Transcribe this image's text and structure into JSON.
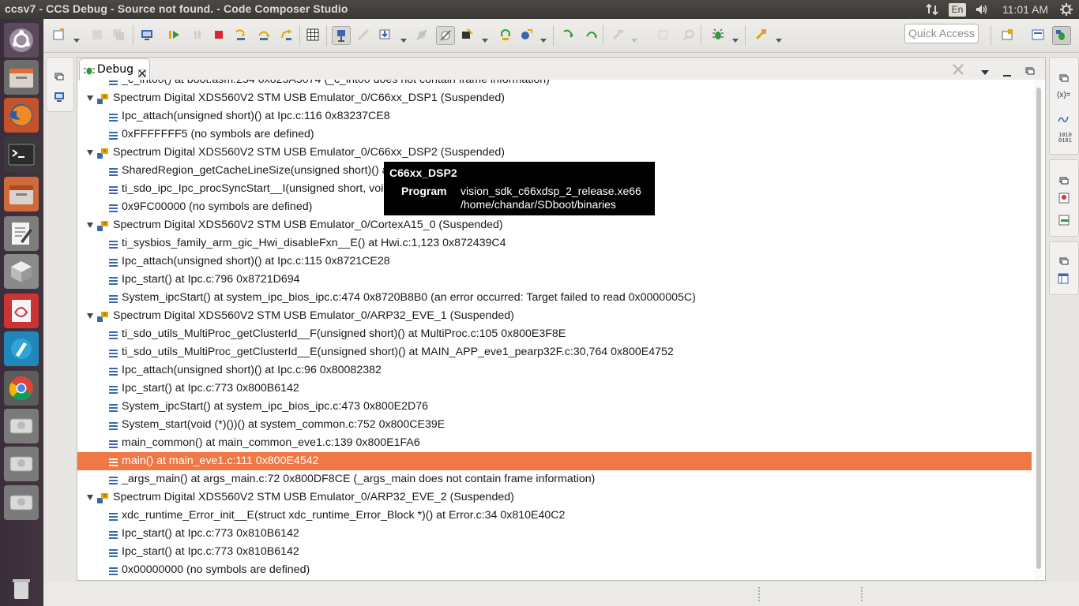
{
  "window": {
    "title": "ccsv7 - CCS Debug - Source not found. - Code Composer Studio"
  },
  "indicators": {
    "language": "En",
    "time": "11:01 AM"
  },
  "toolbar": {
    "quick_access_placeholder": "Quick Access"
  },
  "debug_view": {
    "tab_label": "Debug",
    "rows": [
      {
        "level": 2,
        "kind": "frame",
        "text": "_c_int00() at boot.asm:254 0x823A5074  (_c_int00 does not contain frame information)"
      },
      {
        "level": 1,
        "kind": "target",
        "text": "Spectrum Digital XDS560V2 STM USB Emulator_0/C66xx_DSP1 (Suspended)"
      },
      {
        "level": 2,
        "kind": "frame",
        "text": "Ipc_attach(unsigned short)() at Ipc.c:116 0x83237CE8"
      },
      {
        "level": 2,
        "kind": "frame",
        "text": "0xFFFFFFF5  (no symbols are defined)"
      },
      {
        "level": 1,
        "kind": "target",
        "text": "Spectrum Digital XDS560V2 STM USB Emulator_0/C66xx_DSP2 (Suspended)"
      },
      {
        "level": 2,
        "kind": "frame",
        "text": "SharedRegion_getCacheLineSize(unsigned short)() at SharedRegion.c:316 0x9FC04C8C"
      },
      {
        "level": 2,
        "kind": "frame",
        "text": "ti_sdo_ipc_Ipc_procSyncStart__I(unsigned short, void *)() at Ipc.c:1,187 0x9FC06E40"
      },
      {
        "level": 2,
        "kind": "frame",
        "text": "0x9FC00000  (no symbols are defined)"
      },
      {
        "level": 1,
        "kind": "target",
        "text": "Spectrum Digital XDS560V2 STM USB Emulator_0/CortexA15_0 (Suspended)"
      },
      {
        "level": 2,
        "kind": "frame",
        "text": "ti_sysbios_family_arm_gic_Hwi_disableFxn__E() at Hwi.c:1,123 0x872439C4"
      },
      {
        "level": 2,
        "kind": "frame",
        "text": "Ipc_attach(unsigned short)() at Ipc.c:115 0x8721CE28"
      },
      {
        "level": 2,
        "kind": "frame",
        "text": "Ipc_start() at Ipc.c:796 0x8721D694"
      },
      {
        "level": 2,
        "kind": "frame",
        "text": "System_ipcStart() at system_ipc_bios_ipc.c:474 0x8720B8B0  (an error occurred: Target failed to read 0x0000005C)"
      },
      {
        "level": 1,
        "kind": "target",
        "text": "Spectrum Digital XDS560V2 STM USB Emulator_0/ARP32_EVE_1 (Suspended)"
      },
      {
        "level": 2,
        "kind": "frame",
        "text": "ti_sdo_utils_MultiProc_getClusterId__F(unsigned short)() at MultiProc.c:105 0x800E3F8E"
      },
      {
        "level": 2,
        "kind": "frame",
        "text": "ti_sdo_utils_MultiProc_getClusterId__E(unsigned short)() at MAIN_APP_eve1_pearp32F.c:30,764 0x800E4752"
      },
      {
        "level": 2,
        "kind": "frame",
        "text": "Ipc_attach(unsigned short)() at Ipc.c:96 0x80082382"
      },
      {
        "level": 2,
        "kind": "frame",
        "text": "Ipc_start() at Ipc.c:773 0x800B6142"
      },
      {
        "level": 2,
        "kind": "frame",
        "text": "System_ipcStart() at system_ipc_bios_ipc.c:473 0x800E2D76"
      },
      {
        "level": 2,
        "kind": "frame",
        "text": "System_start(void (*)())() at system_common.c:752 0x800CE39E"
      },
      {
        "level": 2,
        "kind": "frame",
        "text": "main_common() at main_common_eve1.c:139 0x800E1FA6"
      },
      {
        "level": 2,
        "kind": "frame",
        "text": "main() at main_eve1.c:111 0x800E4542",
        "selected": true
      },
      {
        "level": 2,
        "kind": "frame",
        "text": "_args_main() at args_main.c:72 0x800DF8CE  (_args_main does not contain frame information)"
      },
      {
        "level": 1,
        "kind": "target",
        "text": "Spectrum Digital XDS560V2 STM USB Emulator_0/ARP32_EVE_2 (Suspended)"
      },
      {
        "level": 2,
        "kind": "frame",
        "text": "xdc_runtime_Error_init__E(struct xdc_runtime_Error_Block *)() at Error.c:34 0x810E40C2"
      },
      {
        "level": 2,
        "kind": "frame",
        "text": "Ipc_start() at Ipc.c:773 0x810B6142"
      },
      {
        "level": 2,
        "kind": "frame",
        "text": "Ipc_start() at Ipc.c:773 0x810B6142"
      },
      {
        "level": 2,
        "kind": "frame",
        "text": "0x00000000  (no symbols are defined)"
      }
    ]
  },
  "tooltip": {
    "header": "C66xx_DSP2",
    "key": "Program",
    "value_line1": "vision_sdk_c66xdsp_2_release.xe66",
    "value_line2": "/home/chandar/SDboot/binaries"
  },
  "colors": {
    "selection": "#f07746",
    "launcher": "#3b2e3c",
    "topbar": "#3c3b37"
  }
}
